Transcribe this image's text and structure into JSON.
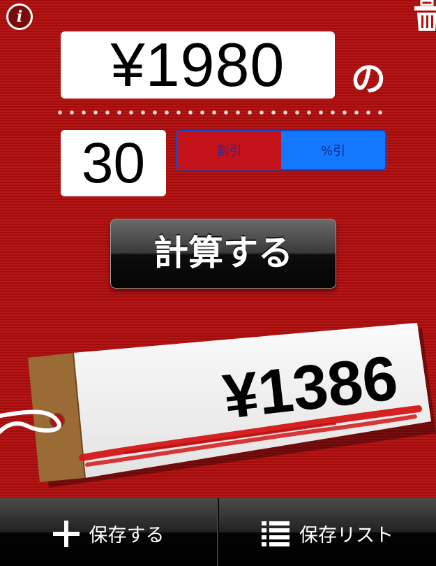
{
  "header": {
    "info_icon_glyph": "i"
  },
  "price": {
    "value": "¥1980",
    "suffix": "の"
  },
  "discount": {
    "value": "30",
    "modes": [
      {
        "label": "割引",
        "selected": false
      },
      {
        "label": "%引",
        "selected": true
      }
    ]
  },
  "actions": {
    "calculate_label": "計算する"
  },
  "result": {
    "value": "¥1386"
  },
  "toolbar": {
    "save_label": "保存する",
    "list_label": "保存リスト"
  },
  "colors": {
    "background": "#b30f0f",
    "segment_selected": "#1478ff",
    "tag_flap": "#9b6b36",
    "underline_red": "#d41616"
  }
}
